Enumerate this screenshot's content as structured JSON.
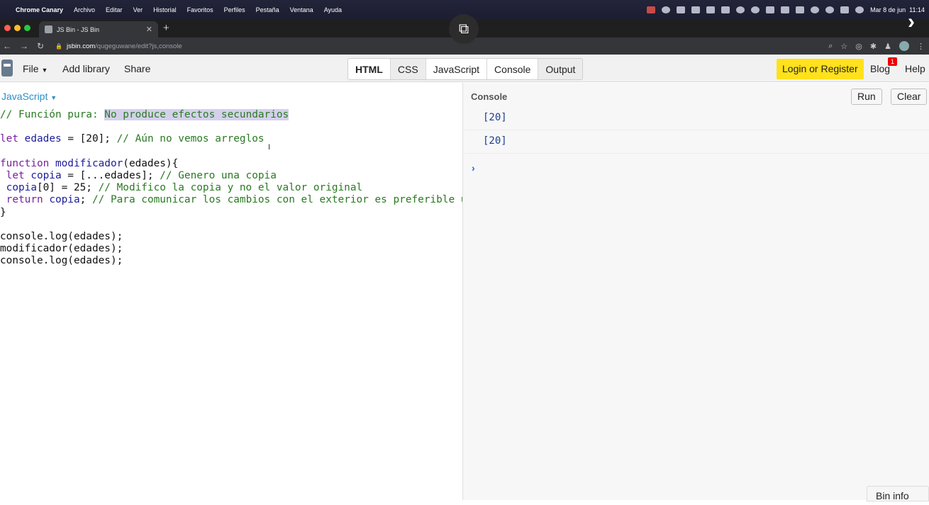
{
  "menubar": {
    "app": "Chrome Canary",
    "items": [
      "Archivo",
      "Editar",
      "Ver",
      "Historial",
      "Favoritos",
      "Perfiles",
      "Pestaña",
      "Ventana",
      "Ayuda"
    ],
    "clock": "Mar 8 de jun  11:14"
  },
  "browser": {
    "tab_title": "JS Bin - JS Bin",
    "url_host": "jsbin.com",
    "url_path": "/qugeguwane/edit?js,console"
  },
  "jsbin": {
    "file": "File",
    "add_library": "Add library",
    "share": "Share",
    "panels": [
      "HTML",
      "CSS",
      "JavaScript",
      "Console",
      "Output"
    ],
    "login": "Login or Register",
    "blog": "Blog",
    "blog_badge": "1",
    "help": "Help",
    "bin_info": "Bin info"
  },
  "editor": {
    "language": "JavaScript",
    "lines": {
      "l1_comment": "// Función pura: ",
      "l1_highlight": "No produce efectos secundarios",
      "l3_kw": "let",
      "l3_name": " edades",
      "l3_rest": " = [20]; ",
      "l3_comment": "// Aún no vemos arreglos",
      "l5_kw": "function",
      "l5_name": " modificador",
      "l5_rest": "(edades){",
      "l6_kw": " let",
      "l6_name": " copia",
      "l6_rest": " = [...edades]; ",
      "l6_comment": "// Genero una copia",
      "l7_name": " copia",
      "l7_rest": "[0] = 25; ",
      "l7_comment": "// Modifico la copia y no el valor original",
      "l8_kw": " return",
      "l8_name": " copia",
      "l8_rest": "; ",
      "l8_comment": "// Para comunicar los cambios con el exterior es preferible u",
      "l9": "}",
      "l11": "console.log(edades);",
      "l12": "modificador(edades);",
      "l13": "console.log(edades);"
    }
  },
  "console": {
    "label": "Console",
    "run": "Run",
    "clear": "Clear",
    "output": [
      "[20]",
      "[20]"
    ],
    "prompt": "›"
  }
}
